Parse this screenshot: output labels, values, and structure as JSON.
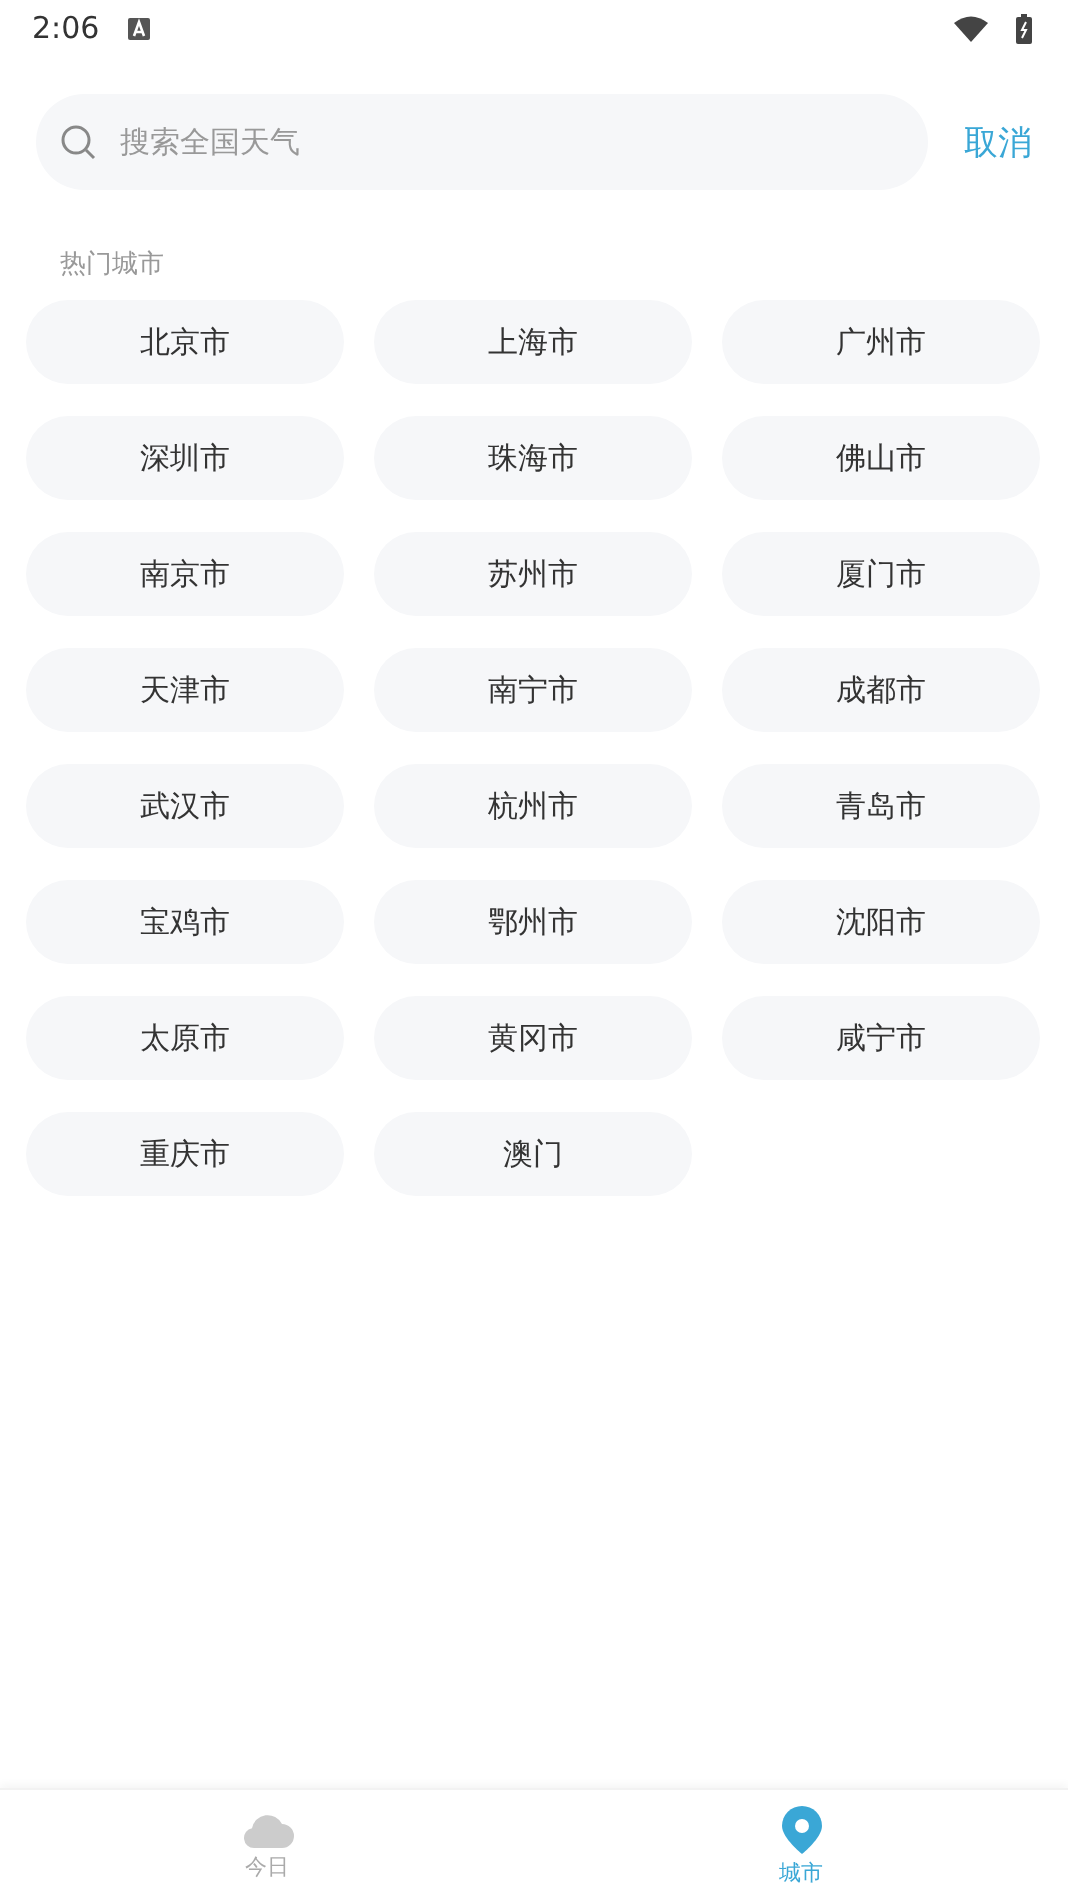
{
  "status_bar": {
    "time": "2:06"
  },
  "search": {
    "placeholder": "搜索全国天气",
    "cancel": "取消"
  },
  "section": {
    "title": "热门城市"
  },
  "cities": [
    "北京市",
    "上海市",
    "广州市",
    "深圳市",
    "珠海市",
    "佛山市",
    "南京市",
    "苏州市",
    "厦门市",
    "天津市",
    "南宁市",
    "成都市",
    "武汉市",
    "杭州市",
    "青岛市",
    "宝鸡市",
    "鄂州市",
    "沈阳市",
    "太原市",
    "黄冈市",
    "咸宁市",
    "重庆市",
    "澳门"
  ],
  "nav": [
    {
      "label": "今日",
      "kind": "cloud",
      "selected": false
    },
    {
      "label": "城市",
      "kind": "pin",
      "selected": true
    }
  ]
}
